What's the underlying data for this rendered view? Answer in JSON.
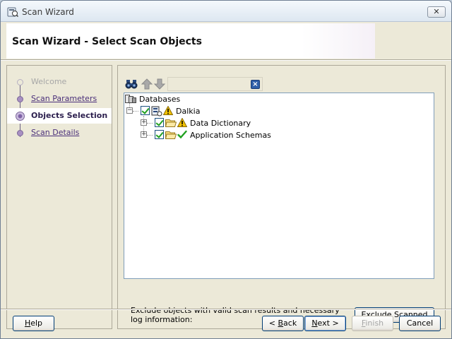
{
  "window": {
    "title": "Scan Wizard",
    "close_label": "✕"
  },
  "header": {
    "title": "Scan Wizard - Select Scan Objects"
  },
  "steps": [
    {
      "label": "Welcome",
      "state": "disabled"
    },
    {
      "label": "Scan Parameters",
      "state": "link"
    },
    {
      "label": "Objects Selection",
      "state": "current"
    },
    {
      "label": "Scan Details",
      "state": "link"
    }
  ],
  "toolbar": {
    "filter_value": "",
    "clear_label": "×"
  },
  "tree": {
    "root": {
      "label": "Databases",
      "icon": "database-icon"
    },
    "db": {
      "label": "Dalkia",
      "expander": "−",
      "checked": true,
      "status": "warning"
    },
    "children": [
      {
        "label": "Data Dictionary",
        "expander": "+",
        "checked": true,
        "status": "warning"
      },
      {
        "label": "Application Schemas",
        "expander": "+",
        "checked": true,
        "status": "ok"
      }
    ]
  },
  "exclude": {
    "text": "Exclude objects with valid scan results and necessary log information:",
    "button_label": "Exclude Scanned"
  },
  "buttons": {
    "help": {
      "mnemonic": "H",
      "rest": "elp"
    },
    "back": {
      "prefix": "< ",
      "mnemonic": "B",
      "rest": "ack"
    },
    "next": {
      "mnemonic": "N",
      "rest": "ext >"
    },
    "finish": {
      "mnemonic": "F",
      "rest": "inish"
    },
    "cancel": "Cancel"
  },
  "colors": {
    "accent": "#7b6699",
    "link": "#4a2f7a",
    "warning": "#f2c200",
    "ok": "#21a121"
  }
}
